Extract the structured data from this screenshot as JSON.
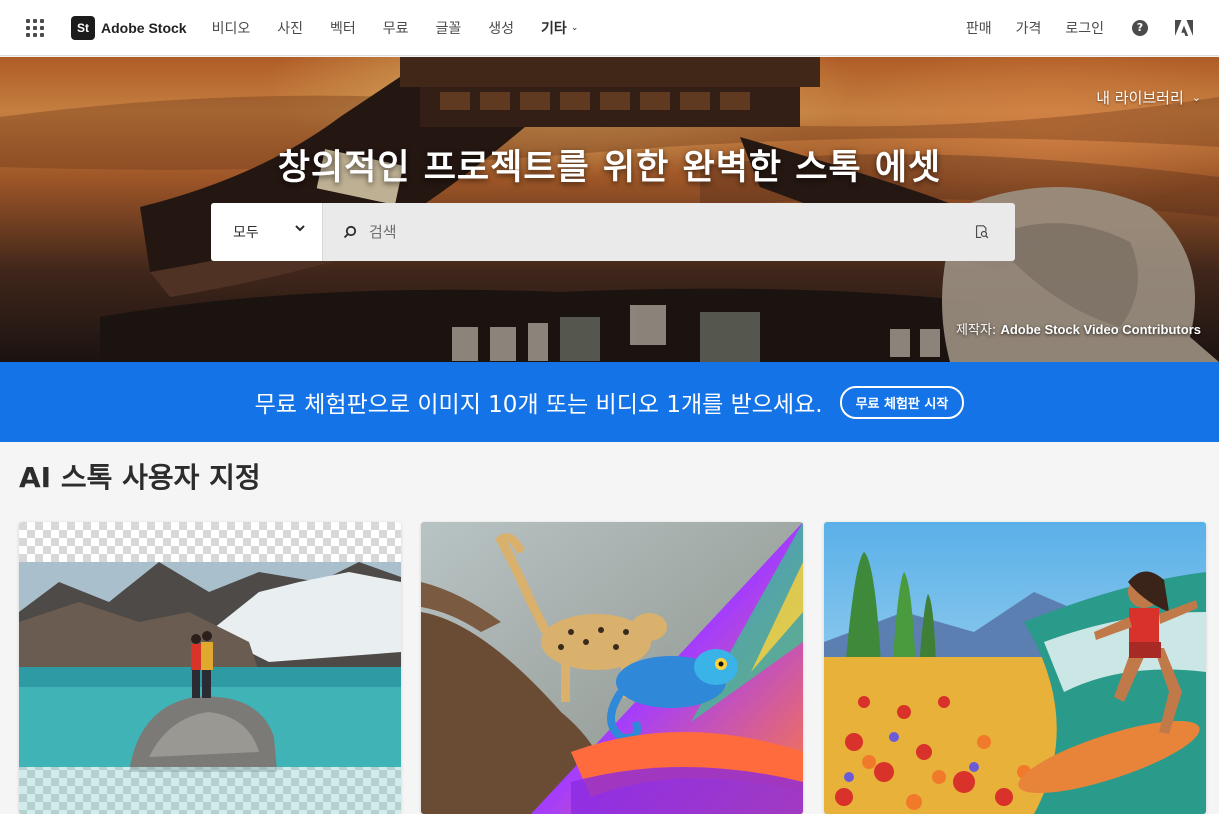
{
  "header": {
    "brand_logo": "St",
    "brand_name": "Adobe Stock",
    "nav": [
      "비디오",
      "사진",
      "벡터",
      "무료",
      "글꼴",
      "생성"
    ],
    "more_label": "기타",
    "sell_label": "판매",
    "pricing_label": "가격",
    "login_label": "로그인",
    "help_icon_glyph": "?"
  },
  "hero": {
    "my_library_label": "내 라이브러리",
    "title": "창의적인 프로젝트를 위한 완벽한 스톡 에셋",
    "search": {
      "category_value": "모두",
      "placeholder": "검색"
    },
    "credit_prefix": "제작자: ",
    "credit_name": "Adobe Stock Video Contributors"
  },
  "promo": {
    "text": "무료 체험판으로 이미지 10개 또는 비디오 1개를 받으세요.",
    "button_label": "무료 체험판 시작"
  },
  "ai_section": {
    "title": "AI 스톡 사용자 지정",
    "cards": [
      {
        "name": "mountain-lake-couple"
      },
      {
        "name": "cheetah-chameleon-branch"
      },
      {
        "name": "surfer-flower-field-painting"
      }
    ]
  },
  "colors": {
    "accent": "#1473e6",
    "nav_text": "#4b4b4b",
    "page_bg": "#f5f5f5"
  }
}
